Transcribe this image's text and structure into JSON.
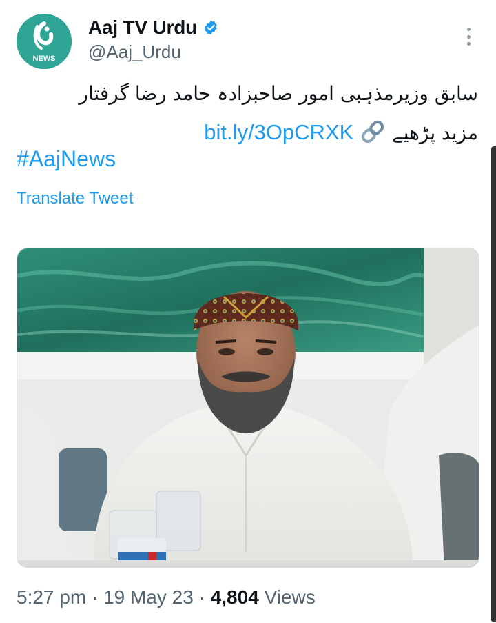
{
  "tweet": {
    "author": {
      "display_name": "Aaj TV Urdu",
      "handle": "@Aaj_Urdu",
      "avatar_label": "NEWS",
      "verified": true
    },
    "text_line_1": "سابق وزیرمذہبی امور صاحبزادہ حامد رضا گرفتار",
    "text_line_2_prefix": "مزید پڑھیے",
    "link_emoji": "link-icon",
    "link_text": "bit.ly/3OpCRXK",
    "hashtag": "#AajNews",
    "translate_label": "Translate Tweet",
    "meta": {
      "time": "5:27 pm",
      "separator": " · ",
      "date": "19 May 23",
      "views_count": "4,804",
      "views_label": "Views"
    }
  },
  "colors": {
    "link": "#1d9bf0",
    "secondary_text": "#536471",
    "avatar_bg": "#2fa596",
    "verified": "#1d9bf0"
  },
  "media": {
    "alt": "photo"
  }
}
